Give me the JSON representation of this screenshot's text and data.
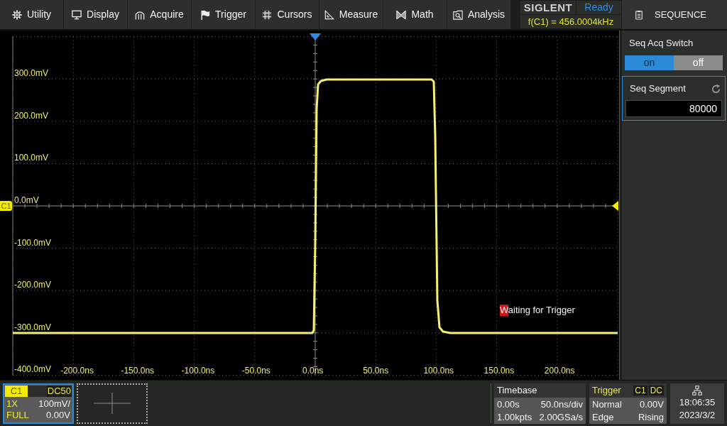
{
  "menu_bar": [
    "Utility",
    "Display",
    "Acquire",
    "Trigger",
    "Cursors",
    "Measure",
    "Math",
    "Analysis"
  ],
  "brand": {
    "logo": "SIGLENT",
    "status": "Ready",
    "frequency": "f(C1) = 456.0004kHz"
  },
  "side_panel": {
    "title": "SEQUENCE",
    "switch": {
      "label": "Seq Acq Switch",
      "options": [
        {
          "label": "on",
          "selected": true
        },
        {
          "label": "off",
          "selected": false
        }
      ]
    },
    "segment": {
      "label": "Seq Segment",
      "value": "80000",
      "focused": true
    }
  },
  "plot": {
    "channel_tag": "C1",
    "y_labels": [
      "300.0mV",
      "200.0mV",
      "100.0mV",
      "0.0mV",
      "-100.0mV",
      "-200.0mV",
      "-300.0mV",
      "-400.0mV"
    ],
    "x_labels": [
      "-200.0ns",
      "-150.0ns",
      "-100.0ns",
      "-50.0ns",
      "0.0ns",
      "50.0ns",
      "100.0ns",
      "150.0ns",
      "200.0ns"
    ],
    "message": "Waiting for Trigger"
  },
  "channel": {
    "name": "C1",
    "coupling": "DC50",
    "probe": "1X",
    "scale": "100mV/",
    "bandwidth": "FULL",
    "offset": "0.00V",
    "selected": true
  },
  "timebase": {
    "title": "Timebase",
    "delay": "0.00s",
    "scale": "50.0ns/div",
    "memory": "1.00kpts",
    "sample_rate": "2.00GSa/s"
  },
  "trigger": {
    "title": "Trigger",
    "source": "C1",
    "coupling": "DC",
    "mode": "Normal",
    "level": "0.00V",
    "type": "Edge",
    "slope": "Rising"
  },
  "clock": {
    "time": "18:06:35",
    "date": "2023/3/2"
  }
}
